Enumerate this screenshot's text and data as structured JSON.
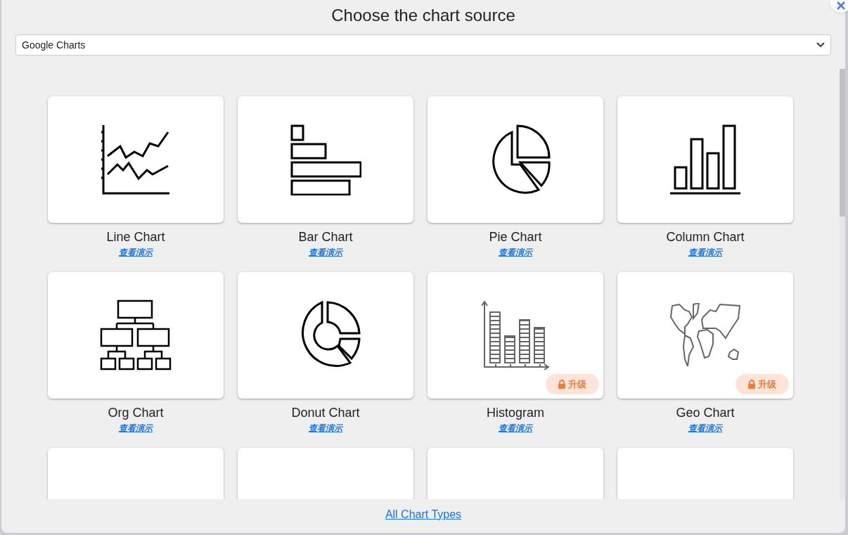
{
  "dialog": {
    "title": "Choose the chart source"
  },
  "source_select": {
    "value": "Google Charts"
  },
  "cards": [
    {
      "kind": "line",
      "name": "Line Chart",
      "demo_link": "查看演示",
      "locked": false
    },
    {
      "kind": "bar",
      "name": "Bar Chart",
      "demo_link": "查看演示",
      "locked": false
    },
    {
      "kind": "pie",
      "name": "Pie Chart",
      "demo_link": "查看演示",
      "locked": false
    },
    {
      "kind": "column",
      "name": "Column Chart",
      "demo_link": "查看演示",
      "locked": false
    },
    {
      "kind": "org",
      "name": "Org Chart",
      "demo_link": "查看演示",
      "locked": false
    },
    {
      "kind": "donut",
      "name": "Donut Chart",
      "demo_link": "查看演示",
      "locked": false
    },
    {
      "kind": "histogram",
      "name": "Histogram",
      "demo_link": "查看演示",
      "locked": true,
      "badge": "升级"
    },
    {
      "kind": "geo",
      "name": "Geo Chart",
      "demo_link": "查看演示",
      "locked": true,
      "badge": "升级"
    },
    {
      "kind": "cut"
    },
    {
      "kind": "cut"
    },
    {
      "kind": "cut"
    },
    {
      "kind": "cut"
    }
  ],
  "footer_link": "All Chart Types"
}
